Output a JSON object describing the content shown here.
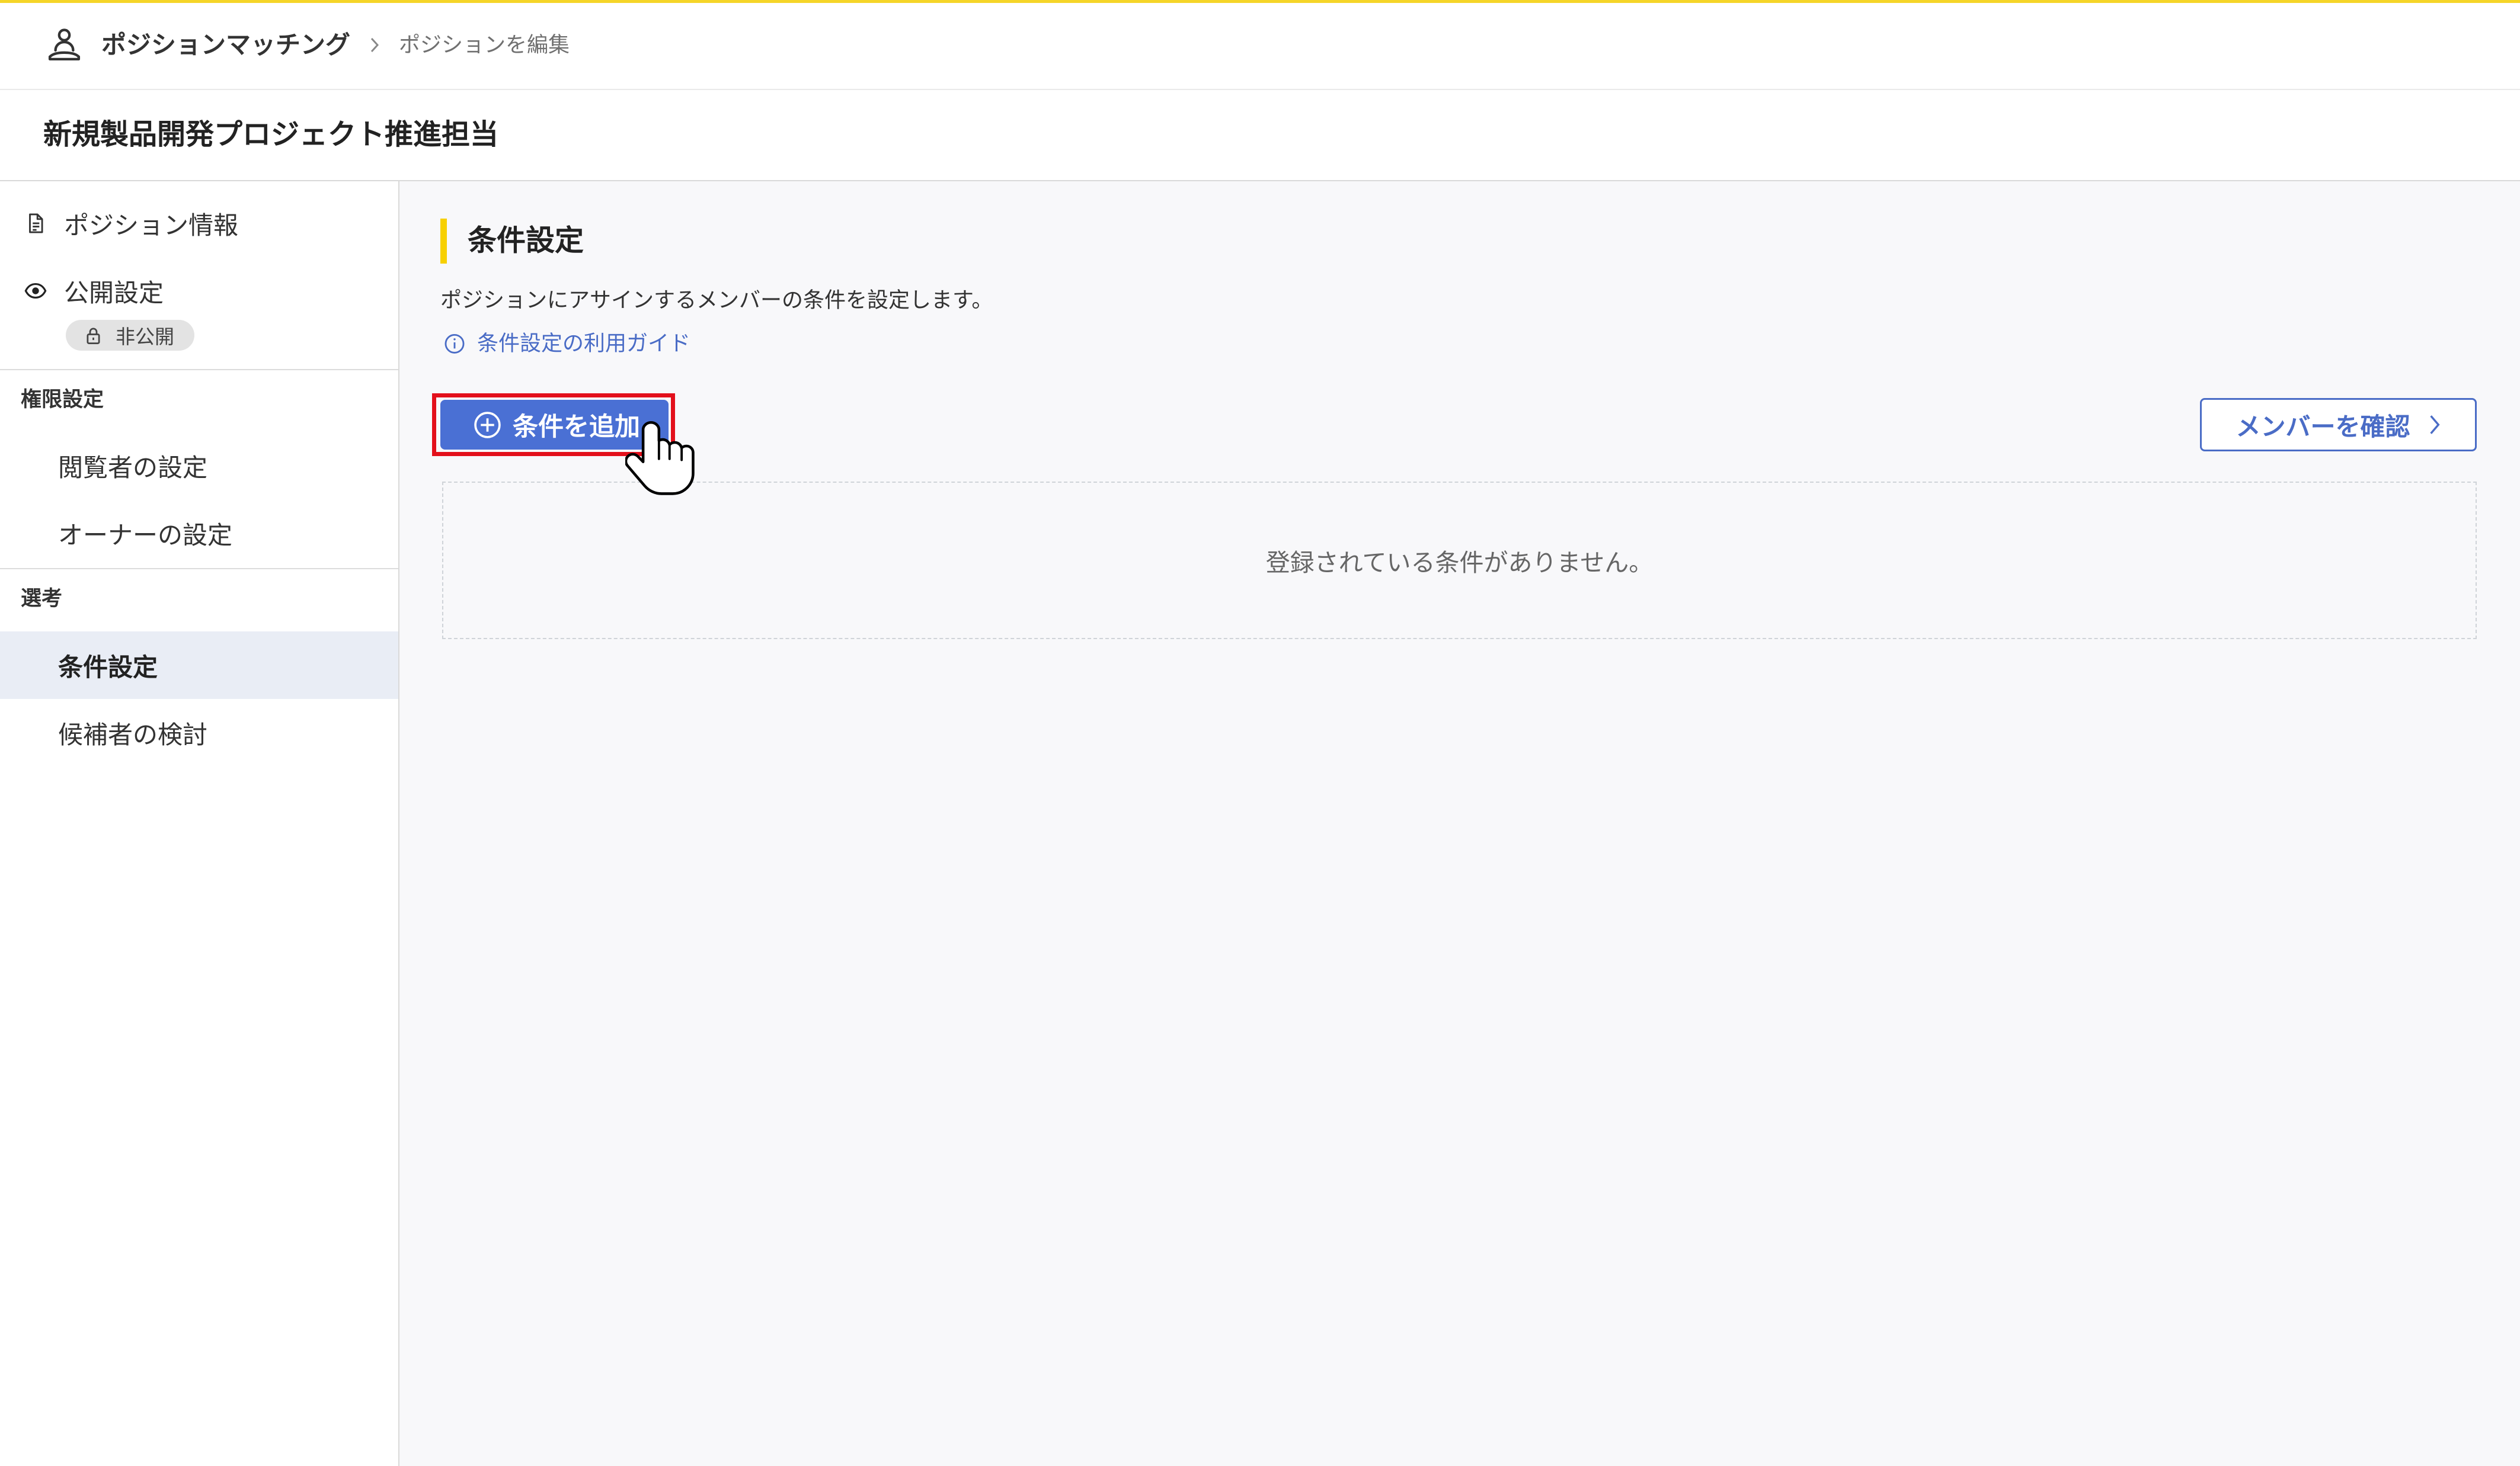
{
  "breadcrumb": {
    "app_icon": "person-badge-icon",
    "app_name": "ポジションマッチング",
    "separator_icon": "chevron-right-icon",
    "current": "ポジションを編集"
  },
  "page_title": "新規製品開発プロジェクト推進担当",
  "sidebar": {
    "items": [
      {
        "label": "ポジション情報",
        "icon": "document-icon"
      },
      {
        "label": "公開設定",
        "icon": "eye-icon",
        "badge": {
          "label": "非公開",
          "icon": "lock-icon"
        }
      }
    ],
    "sections": [
      {
        "title": "権限設定",
        "items": [
          {
            "label": "閲覧者の設定"
          },
          {
            "label": "オーナーの設定"
          }
        ]
      },
      {
        "title": "選考",
        "items": [
          {
            "label": "条件設定",
            "active": true
          },
          {
            "label": "候補者の検討"
          }
        ]
      }
    ]
  },
  "main": {
    "heading": "条件設定",
    "description": "ポジションにアサインするメンバーの条件を設定します。",
    "guide_link": {
      "label": "条件設定の利用ガイド",
      "icon": "info-icon"
    },
    "add_condition_button": {
      "label": "条件を追加",
      "icon": "plus-circle-icon"
    },
    "confirm_members_button": {
      "label": "メンバーを確認",
      "icon": "chevron-right-icon"
    },
    "empty_state": {
      "message": "登録されている条件がありません。"
    }
  },
  "overlay": {
    "cursor_icon": "hand-pointer-cursor-icon"
  },
  "colors": {
    "brand_yellow": "#f5d529",
    "heading_accent": "#f7d000",
    "primary_blue": "#4a70d4",
    "link_blue": "#4a6cc6",
    "active_bg": "#e9edf5",
    "main_bg": "#f8f8fa",
    "annotation_red": "#e3101b"
  }
}
